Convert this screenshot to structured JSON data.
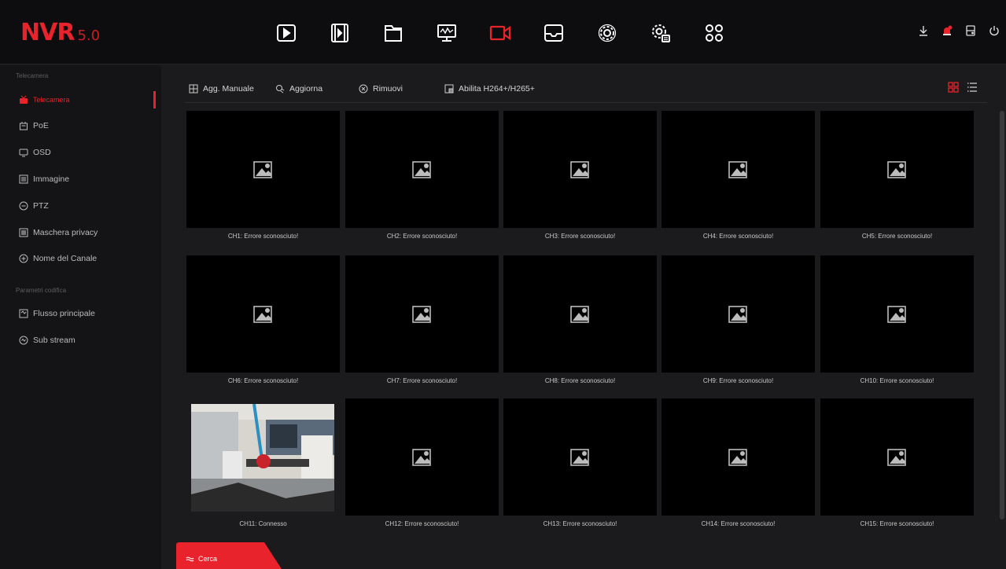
{
  "app": {
    "logo": "NVR",
    "version": "5.0"
  },
  "topnav": [
    {
      "icon": "playback-icon"
    },
    {
      "icon": "video-file-icon"
    },
    {
      "icon": "folder-icon"
    },
    {
      "icon": "monitor-icon"
    },
    {
      "icon": "camera-icon",
      "active": true
    },
    {
      "icon": "inbox-icon"
    },
    {
      "icon": "settings-icon"
    },
    {
      "icon": "advanced-settings-icon"
    },
    {
      "icon": "apps-icon"
    }
  ],
  "topright": [
    "download-icon",
    "alarm-icon",
    "storage-icon",
    "power-icon"
  ],
  "colors": {
    "accent": "#e8232b",
    "bg": "#1b1b1d",
    "sidebar": "#141416"
  },
  "sidebar": {
    "section1": "Telecamera",
    "items1": [
      {
        "label": "Telecamera",
        "icon": "camera-icon"
      },
      {
        "label": "PoE",
        "icon": "poe-icon"
      },
      {
        "label": "OSD",
        "icon": "osd-icon"
      },
      {
        "label": "Immagine",
        "icon": "image-icon"
      },
      {
        "label": "PTZ",
        "icon": "ptz-icon"
      },
      {
        "label": "Maschera privacy",
        "icon": "privacy-mask-icon"
      },
      {
        "label": "Nome del Canale",
        "icon": "channel-name-icon"
      }
    ],
    "section2": "Parametri codifica",
    "items2": [
      {
        "label": "Flusso principale",
        "icon": "main-stream-icon"
      },
      {
        "label": "Sub stream",
        "icon": "sub-stream-icon"
      }
    ]
  },
  "toolbar": {
    "add_manual": "Agg. Manuale",
    "refresh": "Aggiorna",
    "remove": "Rimuovi",
    "enable_h264": "Abilita H264+/H265+"
  },
  "channels": [
    "CH1: Errore sconosciuto!",
    "CH2: Errore sconosciuto!",
    "CH3: Errore sconosciuto!",
    "CH4: Errore sconosciuto!",
    "CH5: Errore sconosciuto!",
    "CH6: Errore sconosciuto!",
    "CH7: Errore sconosciuto!",
    "CH8: Errore sconosciuto!",
    "CH9: Errore sconosciuto!",
    "CH10: Errore sconosciuto!",
    "CH11: Connesso",
    "CH12: Errore sconosciuto!",
    "CH13: Errore sconosciuto!",
    "CH14: Errore sconosciuto!",
    "CH15: Errore sconosciuto!"
  ],
  "search": {
    "label": "Cerca"
  }
}
